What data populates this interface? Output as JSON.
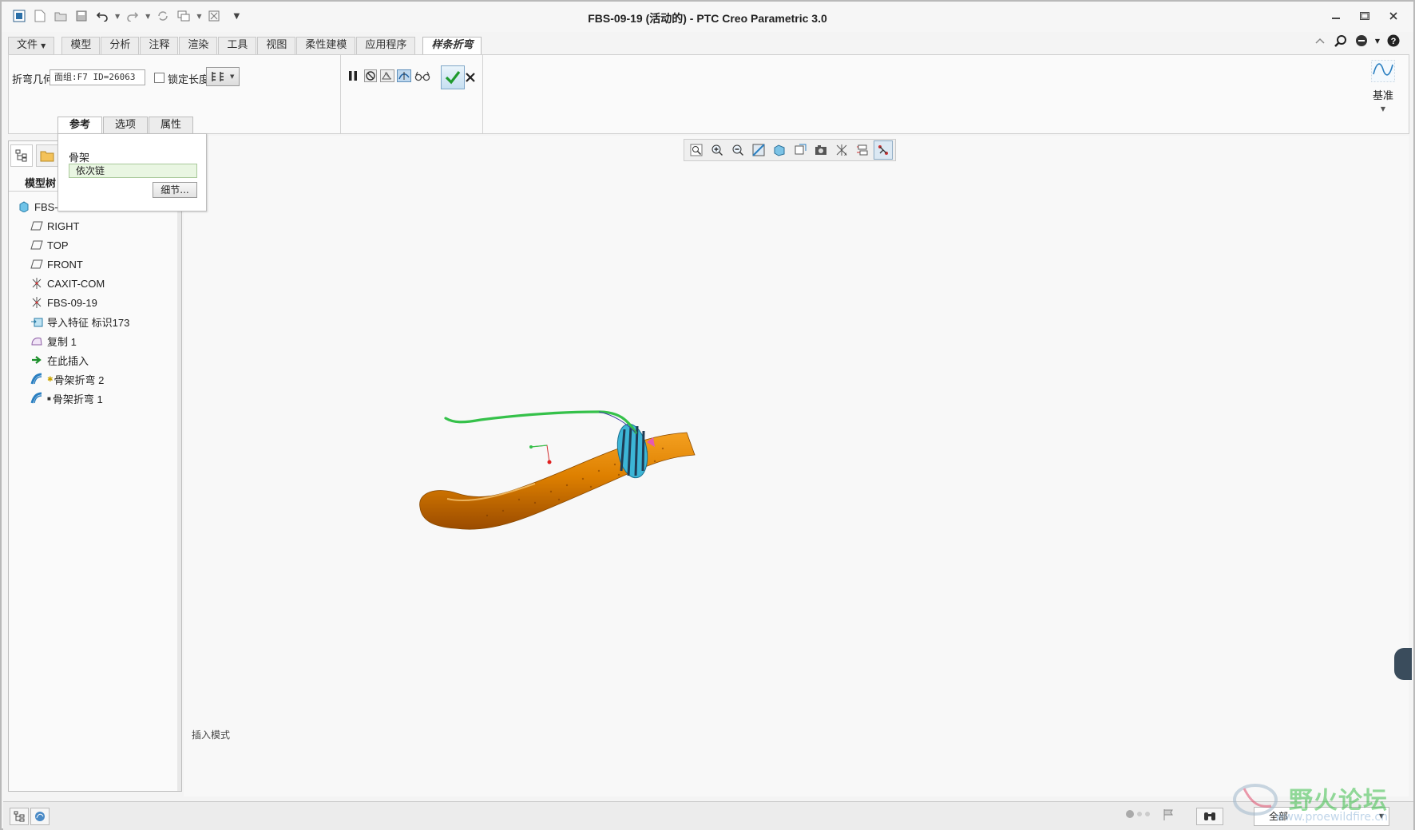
{
  "window": {
    "title": "FBS-09-19 (活动的) - PTC Creo Parametric 3.0"
  },
  "ribbon_tabs": [
    "文件",
    "模型",
    "分析",
    "注释",
    "渲染",
    "工具",
    "视图",
    "柔性建模",
    "应用程序"
  ],
  "active_tab": "样条折弯",
  "dashboard": {
    "bend_geometry_label": "折弯几何",
    "bend_geometry_value": "面组:F7 ID=26063",
    "lock_length_label": "锁定长度",
    "lock_length_checked": false,
    "datum_label": "基准"
  },
  "subtabs": [
    "参考",
    "选项",
    "属性"
  ],
  "references_panel": {
    "skeleton_label": "骨架",
    "skeleton_value": "依次链",
    "details_button": "细节..."
  },
  "left_panel": {
    "title": "模型树",
    "tree": [
      {
        "label": "FBS-0",
        "icon": "part-icon"
      },
      {
        "label": "RIGHT",
        "icon": "datum-plane-icon"
      },
      {
        "label": "TOP",
        "icon": "datum-plane-icon"
      },
      {
        "label": "FRONT",
        "icon": "datum-plane-icon"
      },
      {
        "label": "CAXIT-COM",
        "icon": "coordinate-system-icon"
      },
      {
        "label": "FBS-09-19",
        "icon": "coordinate-system-icon"
      },
      {
        "label": "导入特征 标识173",
        "icon": "import-feature-icon"
      },
      {
        "label": "复制 1",
        "icon": "copy-surface-icon"
      },
      {
        "label": "在此插入",
        "icon": "insert-here-arrow-icon"
      },
      {
        "label": "骨架折弯 2",
        "icon": "spinal-bend-icon"
      },
      {
        "label": "骨架折弯 1",
        "icon": "spinal-bend-icon"
      }
    ]
  },
  "graphics": {
    "mode_text": "插入模式"
  },
  "statusbar": {
    "filter_value": "全部"
  },
  "watermark": {
    "text": "野火论坛",
    "url": "www.proewildfire.cn"
  },
  "colors": {
    "spine_green": "#35c14a",
    "handle_orange": "#e08400",
    "selection_cyan": "#35b8d8",
    "accept_green": "#1f9a2e"
  }
}
